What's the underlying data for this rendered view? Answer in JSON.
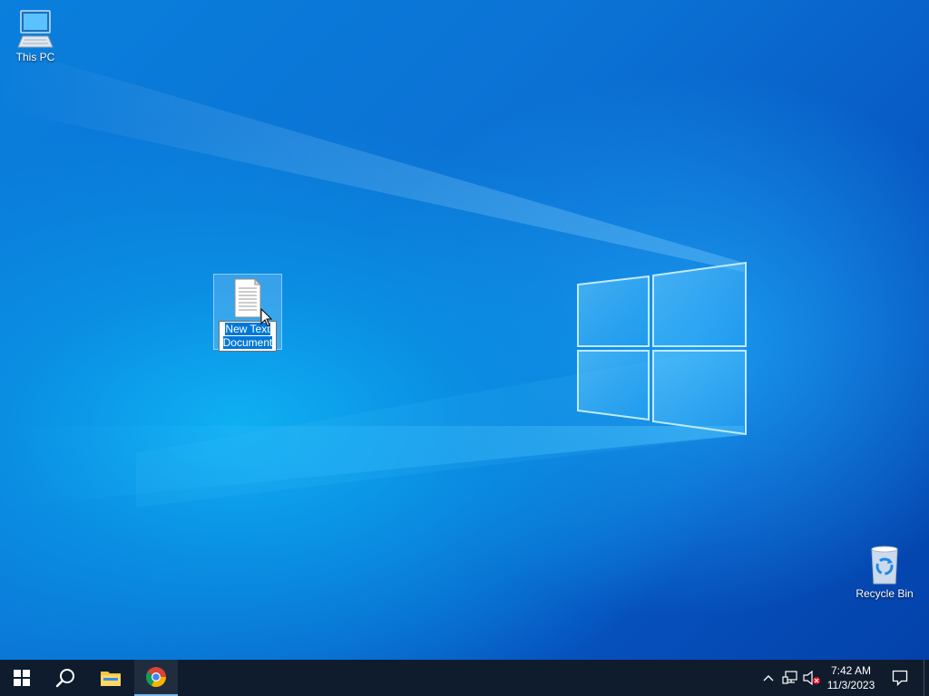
{
  "desktop": {
    "icons": [
      {
        "label": "This PC",
        "icon": "computer-icon"
      },
      {
        "label": "New Text Document",
        "icon": "text-document-icon",
        "state": "renaming"
      },
      {
        "label": "Recycle Bin",
        "icon": "recycle-bin-icon"
      }
    ],
    "rename_value": "New Text Document"
  },
  "taskbar": {
    "buttons": [
      {
        "name": "start",
        "icon": "windows-logo-icon"
      },
      {
        "name": "search",
        "icon": "search-icon"
      },
      {
        "name": "file-explorer",
        "icon": "folder-icon"
      },
      {
        "name": "chrome",
        "icon": "chrome-icon",
        "active": true
      }
    ],
    "tray": {
      "icons": [
        "chevron-up-icon",
        "network-icon",
        "volume-muted-icon"
      ],
      "time": "7:42 AM",
      "date": "11/3/2023"
    },
    "action_center_icon": "notification-icon"
  },
  "colors": {
    "accent": "#0078d7",
    "taskbar": "#101c2c",
    "wallpaper_blue": "#0a7fdc"
  }
}
